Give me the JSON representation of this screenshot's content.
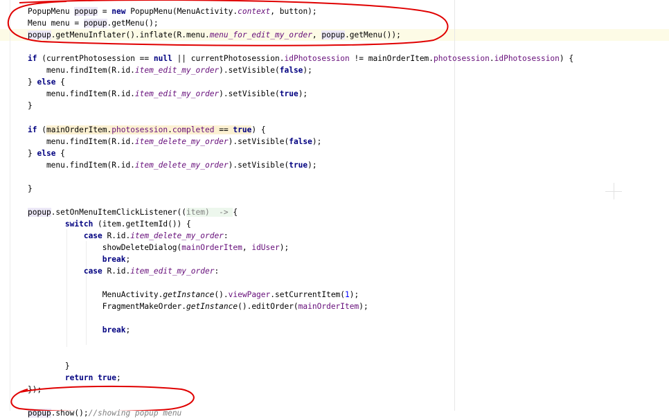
{
  "editor": {
    "lines": [
      [
        {
          "t": "PopupMenu "
        },
        {
          "t": "popup",
          "c": "var"
        },
        {
          "t": " = "
        },
        {
          "t": "new",
          "c": "kw"
        },
        {
          "t": " PopupMenu(MenuActivity."
        },
        {
          "t": "context",
          "c": "fldi"
        },
        {
          "t": ", button);"
        }
      ],
      [
        {
          "t": "Menu menu = "
        },
        {
          "t": "popup",
          "c": "var"
        },
        {
          "t": ".getMenu();"
        }
      ],
      [
        {
          "t": "popup",
          "c": "var"
        },
        {
          "t": ".getMenuInflater().inflate(R.menu."
        },
        {
          "t": "menu_for_edit_my_order",
          "c": "fldi"
        },
        {
          "t": ", "
        },
        {
          "t": "popup",
          "c": "var"
        },
        {
          "t": ".getMenu());"
        }
      ],
      [],
      [
        {
          "t": "if",
          "c": "kw"
        },
        {
          "t": " (currentPhotosession == "
        },
        {
          "t": "null",
          "c": "kw"
        },
        {
          "t": " || currentPhotosession."
        },
        {
          "t": "idPhotosession",
          "c": "fld"
        },
        {
          "t": " != mainOrderItem."
        },
        {
          "t": "photosession",
          "c": "fld"
        },
        {
          "t": "."
        },
        {
          "t": "idPhotosession",
          "c": "fld"
        },
        {
          "t": ") {"
        }
      ],
      [
        {
          "t": "    menu.findItem(R.id."
        },
        {
          "t": "item_edit_my_order",
          "c": "fldi"
        },
        {
          "t": ").setVisible("
        },
        {
          "t": "false",
          "c": "kw"
        },
        {
          "t": ");"
        }
      ],
      [
        {
          "t": "} "
        },
        {
          "t": "else",
          "c": "kw"
        },
        {
          "t": " {"
        }
      ],
      [
        {
          "t": "    menu.findItem(R.id."
        },
        {
          "t": "item_edit_my_order",
          "c": "fldi"
        },
        {
          "t": ").setVisible("
        },
        {
          "t": "true",
          "c": "kw"
        },
        {
          "t": ");"
        }
      ],
      [
        {
          "t": "}"
        }
      ],
      [],
      [
        {
          "t": "if",
          "c": "kw"
        },
        {
          "t": " ("
        },
        {
          "t": "mainOrderItem.",
          "c": "cond"
        },
        {
          "t": "photosession",
          "c": "fld cond"
        },
        {
          "t": ".",
          "c": "cond"
        },
        {
          "t": "completed",
          "c": "fld cond"
        },
        {
          "t": " == ",
          "c": "cond"
        },
        {
          "t": "true",
          "c": "kw cond"
        },
        {
          "t": ") {"
        }
      ],
      [
        {
          "t": "    menu.findItem(R.id."
        },
        {
          "t": "item_delete_my_order",
          "c": "fldi"
        },
        {
          "t": ").setVisible("
        },
        {
          "t": "false",
          "c": "kw"
        },
        {
          "t": ");"
        }
      ],
      [
        {
          "t": "} "
        },
        {
          "t": "else",
          "c": "kw"
        },
        {
          "t": " {"
        }
      ],
      [
        {
          "t": "    menu.findItem(R.id."
        },
        {
          "t": "item_delete_my_order",
          "c": "fldi"
        },
        {
          "t": ").setVisible("
        },
        {
          "t": "true",
          "c": "kw"
        },
        {
          "t": ");"
        }
      ],
      [],
      [
        {
          "t": "}"
        }
      ],
      [],
      [
        {
          "t": "popup",
          "c": "var"
        },
        {
          "t": ".setOnMenuItemClickListener(("
        },
        {
          "t": "item) ",
          "c": "hint"
        },
        {
          "t": " -> ",
          "c": "hint"
        },
        {
          "t": "{"
        }
      ],
      [
        {
          "t": "        "
        },
        {
          "t": "switch",
          "c": "kw"
        },
        {
          "t": " (item.getItemId()) {"
        }
      ],
      [
        {
          "t": "            "
        },
        {
          "t": "case",
          "c": "kw"
        },
        {
          "t": " R.id."
        },
        {
          "t": "item_delete_my_order",
          "c": "fldi"
        },
        {
          "t": ":"
        }
      ],
      [
        {
          "t": "                showDeleteDialog("
        },
        {
          "t": "mainOrderItem",
          "c": "fld"
        },
        {
          "t": ", "
        },
        {
          "t": "idUser",
          "c": "fld"
        },
        {
          "t": ");"
        }
      ],
      [
        {
          "t": "                "
        },
        {
          "t": "break",
          "c": "kw"
        },
        {
          "t": ";"
        }
      ],
      [
        {
          "t": "            "
        },
        {
          "t": "case",
          "c": "kw"
        },
        {
          "t": " R.id."
        },
        {
          "t": "item_edit_my_order",
          "c": "fldi"
        },
        {
          "t": ":"
        }
      ],
      [],
      [
        {
          "t": "                MenuActivity."
        },
        {
          "t": "getInstance",
          "c": "sti"
        },
        {
          "t": "()."
        },
        {
          "t": "viewPager",
          "c": "fld"
        },
        {
          "t": ".setCurrentItem("
        },
        {
          "t": "1",
          "c": "num"
        },
        {
          "t": ");"
        }
      ],
      [
        {
          "t": "                FragmentMakeOrder."
        },
        {
          "t": "getInstance",
          "c": "sti"
        },
        {
          "t": "().editOrder("
        },
        {
          "t": "mainOrderItem",
          "c": "fld"
        },
        {
          "t": ");"
        }
      ],
      [],
      [
        {
          "t": "                "
        },
        {
          "t": "break",
          "c": "kw"
        },
        {
          "t": ";"
        }
      ],
      [],
      [],
      [
        {
          "t": "        }"
        }
      ],
      [
        {
          "t": "        "
        },
        {
          "t": "return",
          "c": "kw"
        },
        {
          "t": " "
        },
        {
          "t": "true",
          "c": "kw"
        },
        {
          "t": ";"
        }
      ],
      [
        {
          "t": "});"
        }
      ],
      [],
      [
        {
          "t": "popup",
          "c": "var"
        },
        {
          "t": ".show();"
        },
        {
          "t": "//showing popup menu",
          "c": "cmt"
        }
      ]
    ]
  },
  "annotations": {
    "color": "#e00000"
  },
  "colors": {
    "keyword": "#000080",
    "field": "#660e7a",
    "number": "#0000ff",
    "comment": "#808080"
  }
}
